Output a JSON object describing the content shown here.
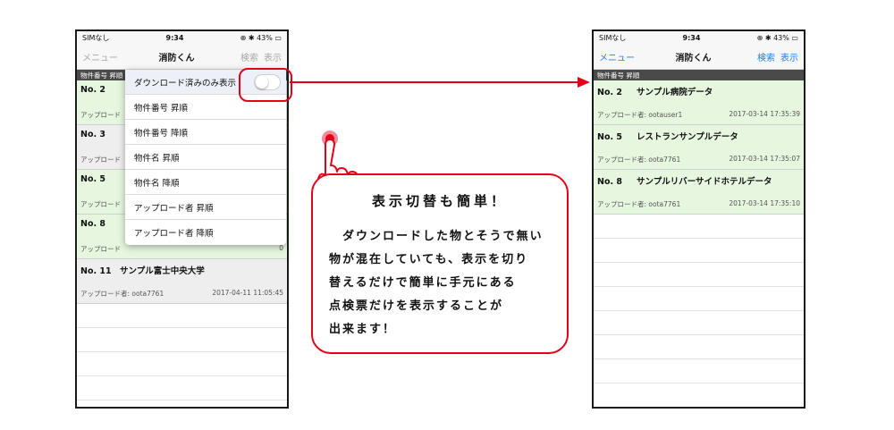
{
  "left_phone": {
    "status": {
      "carrier": "SIMなし",
      "time": "9:34",
      "battery": "43%"
    },
    "nav": {
      "menu": "メニュー",
      "title": "消防くん",
      "search": "検索",
      "display": "表示"
    },
    "section_header": "物件番号 昇順",
    "rows": [
      {
        "num": "No. 2",
        "name": "",
        "uploader": "アップロード",
        "date": "9",
        "color": "green"
      },
      {
        "num": "No. 3",
        "name": "",
        "uploader": "アップロード",
        "date": "3",
        "color": "gray"
      },
      {
        "num": "No. 5",
        "name": "",
        "uploader": "アップロード",
        "date": "7",
        "color": "green"
      },
      {
        "num": "No. 8",
        "name": "",
        "uploader": "アップロード",
        "date": "0",
        "color": "green"
      },
      {
        "num": "No. 11",
        "name": "サンプル富士中央大学",
        "uploader": "アップロード者: oota7761",
        "date": "2017-04-11 11:05:45",
        "color": "gray"
      }
    ],
    "dropdown": {
      "toggle_label": "ダウンロード済みのみ表示",
      "toggle_on": false,
      "items": [
        "物件番号 昇順",
        "物件番号 降順",
        "物件名 昇順",
        "物件名 降順",
        "アップロード者 昇順",
        "アップロード者 降順"
      ]
    }
  },
  "right_phone": {
    "status": {
      "carrier": "SIMなし",
      "time": "9:34",
      "battery": "43%"
    },
    "nav": {
      "menu": "メニュー",
      "title": "消防くん",
      "search": "検索",
      "display": "表示"
    },
    "section_header": "物件番号 昇順",
    "rows": [
      {
        "num": "No. 2",
        "name": "サンプル病院データ",
        "uploader": "アップロード者: ootauser1",
        "date": "2017-03-14 17:35:39"
      },
      {
        "num": "No. 5",
        "name": "レストランサンプルデータ",
        "uploader": "アップロード者: oota7761",
        "date": "2017-03-14 17:35:07"
      },
      {
        "num": "No. 8",
        "name": "サンプルリバーサイドホテルデータ",
        "uploader": "アップロード者: oota7761",
        "date": "2017-03-14 17:35:10"
      }
    ]
  },
  "callout": {
    "title": "表示切替も簡単！",
    "body": "　ダウンロードした物とそうで無い\n物が混在していても、表示を切り\n替えるだけで簡単に手元にある\n点検票だけを表示することが\n出来ます！"
  },
  "colors": {
    "accent": "#e2001a",
    "ios_blue": "#1e7ef0",
    "row_green": "#e6f6df"
  }
}
